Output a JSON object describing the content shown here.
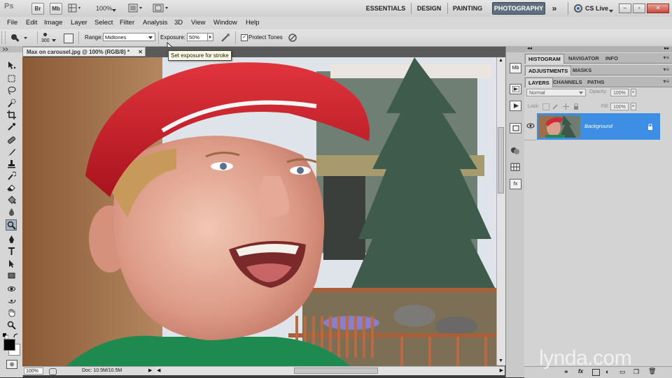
{
  "appbar": {
    "logo": "Ps",
    "bridge_label": "Br",
    "minibridge_label": "Mb",
    "zoom": "100%",
    "workspaces": [
      "ESSENTIALS",
      "DESIGN",
      "PAINTING",
      "PHOTOGRAPHY"
    ],
    "more_label": "»",
    "cslive_label": "CS Live"
  },
  "menus": [
    "File",
    "Edit",
    "Image",
    "Layer",
    "Select",
    "Filter",
    "Analysis",
    "3D",
    "View",
    "Window",
    "Help"
  ],
  "options": {
    "brush_size": "300",
    "range_label": "Range:",
    "range_value": "Midtones",
    "exposure_label": "Exposure:",
    "exposure_value": "50%",
    "protect_tones_label": "Protect Tones",
    "protect_tones_checked": true,
    "tooltip": "Set exposure for stroke"
  },
  "document": {
    "tab_title": "Max on carousel.jpg @ 100% (RGB/8) *",
    "zoom": "100%",
    "doc_info": "Doc: 10.5M/10.5M"
  },
  "panels": {
    "group1_tabs": [
      "HISTOGRAM",
      "NAVIGATOR",
      "INFO"
    ],
    "group2_tabs": [
      "ADJUSTMENTS",
      "MASKS"
    ],
    "group3_tabs": [
      "LAYERS",
      "CHANNELS",
      "PATHS"
    ],
    "blend_mode": "Normal",
    "opacity_label": "Opacity:",
    "opacity_value": "100%",
    "lock_label": "Lock:",
    "fill_label": "Fill:",
    "fill_value": "100%",
    "layer_name": "Background"
  },
  "watermark": "lynda.com",
  "colors": {
    "active_workspace": "#5d6e7e",
    "selected_layer": "#3f8ee6"
  }
}
